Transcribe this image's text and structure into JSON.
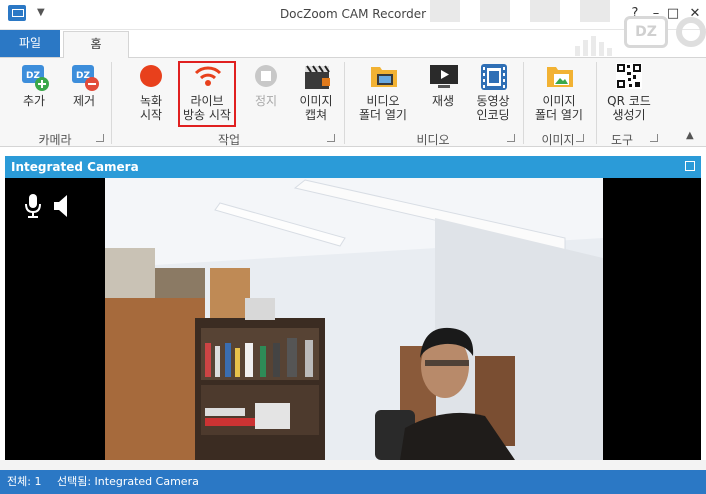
{
  "window": {
    "title": "DocZoom CAM Recorder",
    "help": "?",
    "minimize": "–",
    "maximize": "□",
    "close": "✕"
  },
  "tabs": {
    "file": "파일",
    "home": "홈"
  },
  "ribbon": {
    "groups": {
      "camera": "카메라",
      "task": "작업",
      "video": "비디오",
      "image": "이미지",
      "tools": "도구"
    },
    "buttons": {
      "add": "추가",
      "remove": "제거",
      "record_line1": "녹화",
      "record_line2": "시작",
      "live_line1": "라이브",
      "live_line2": "방송 시작",
      "stop": "정지",
      "capture_line1": "이미지",
      "capture_line2": "캡쳐",
      "video_folder_line1": "비디오",
      "video_folder_line2": "폴더 열기",
      "play": "재생",
      "encode_line1": "동영상",
      "encode_line2": "인코딩",
      "image_folder_line1": "이미지",
      "image_folder_line2": "폴더 열기",
      "qr_line1": "QR 코드",
      "qr_line2": "생성기"
    },
    "logo": "DZ"
  },
  "panel": {
    "title": "Integrated Camera"
  },
  "status": {
    "total": "전체: 1",
    "selected": "선택됨: Integrated Camera"
  },
  "colors": {
    "accent": "#2b78c5",
    "panel_header": "#2b9bd8",
    "record_red": "#e8401c",
    "highlight": "#e02020"
  }
}
